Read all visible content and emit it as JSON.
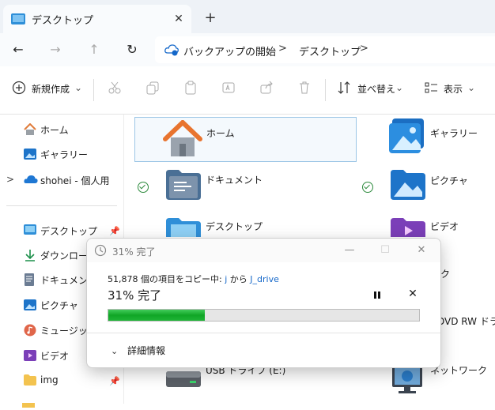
{
  "tab": {
    "title": "デスクトップ",
    "close": "✕",
    "new": "+"
  },
  "nav": {
    "back": "←",
    "forward": "→",
    "up": "↑",
    "refresh": "↻"
  },
  "address": {
    "crumbs": [
      "バックアップの開始",
      "デスクトップ"
    ],
    "separator": ">"
  },
  "command_bar": {
    "new_label": "新規作成",
    "sort_label": "並べ替え",
    "view_label": "表示"
  },
  "sidebar": {
    "top": [
      {
        "label": "ホーム",
        "icon": "home-icon"
      },
      {
        "label": "ギャラリー",
        "icon": "gallery-icon"
      },
      {
        "label": "shohei - 個人用",
        "icon": "onedrive-icon",
        "expander": ">"
      }
    ],
    "quick": [
      {
        "label": "デスクトップ",
        "icon": "desktop-folder-icon"
      },
      {
        "label": "ダウンロード",
        "icon": "download-icon"
      },
      {
        "label": "ドキュメント",
        "icon": "document-icon"
      },
      {
        "label": "ピクチャ",
        "icon": "picture-icon"
      },
      {
        "label": "ミュージック",
        "icon": "music-icon"
      },
      {
        "label": "ビデオ",
        "icon": "video-icon"
      },
      {
        "label": "img",
        "icon": "folder-icon"
      }
    ]
  },
  "content": {
    "home": "ホーム",
    "gallery": "ギャラリー",
    "documents": "ドキュメント",
    "pictures": "ピクチャ",
    "desktop": "デスクトップ",
    "videos": "ビデオ",
    "dvd": "DVD RW ドライブ",
    "usb": "USB ドライブ (E:)",
    "network": "ネットワーク",
    "partial_k": "ク"
  },
  "dialog": {
    "title": "31% 完了",
    "msg_prefix": "51,878 個の項目をコピー中:",
    "source": "j",
    "from": "から",
    "dest": "J_drive",
    "percent_text": "31% 完了",
    "progress": 0.31,
    "more_details": "詳細情報",
    "minimize": "—",
    "maximize": "☐",
    "close": "✕",
    "cancel": "✕"
  },
  "colors": {
    "accent": "#1467c9",
    "progress": "#10a626",
    "folder": "#2f8fd8"
  }
}
